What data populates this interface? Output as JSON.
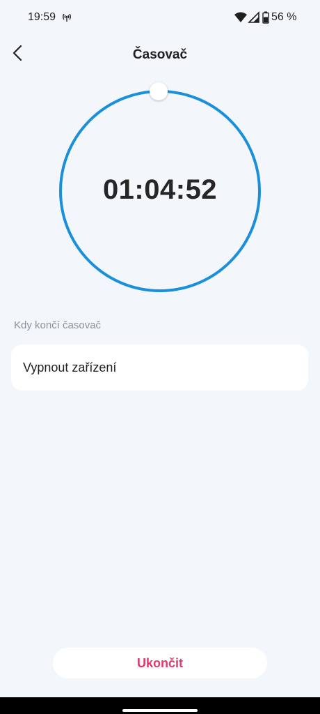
{
  "status_bar": {
    "time": "19:59",
    "battery": "56 %",
    "icons": [
      "hotspot-icon",
      "wifi-icon",
      "cellular-signal-icon",
      "battery-icon"
    ]
  },
  "header": {
    "title": "Časovač",
    "back_icon": "chevron-left-icon"
  },
  "timer": {
    "value": "01:04:52",
    "ring_color": "#1a8fda"
  },
  "end_action": {
    "section_label": "Kdy končí časovač",
    "option_label": "Vypnout zařízení"
  },
  "footer": {
    "stop_label": "Ukončit",
    "stop_color": "#e2386b"
  }
}
